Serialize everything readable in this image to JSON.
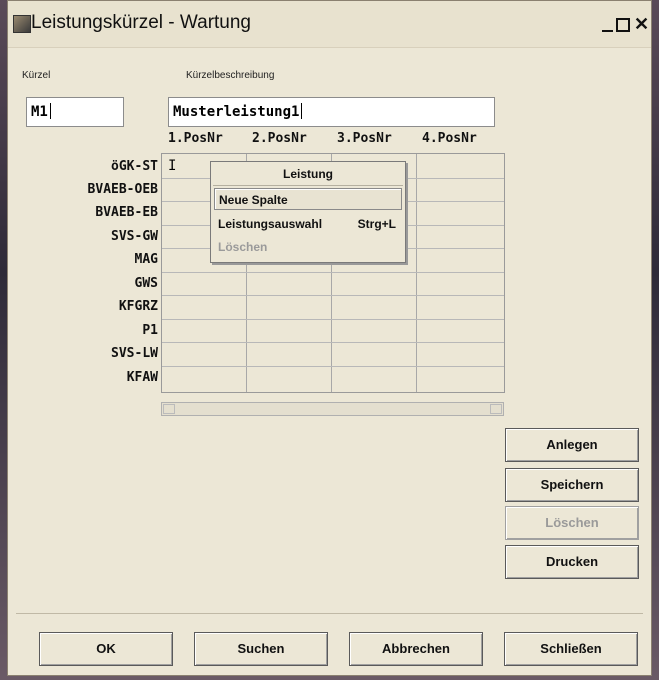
{
  "window": {
    "title": "Leistungskürzel - Wartung"
  },
  "form": {
    "kuerzel_label": "Kürzel",
    "kuerzel_value": "M1",
    "beschreibung_label": "Kürzelbeschreibung",
    "beschreibung_value": "Musterleistung1"
  },
  "grid": {
    "columns": [
      "1.PosNr",
      "2.PosNr",
      "3.PosNr",
      "4.PosNr"
    ],
    "rows": [
      "öGK-ST",
      "BVAEB-OEB",
      "BVAEB-EB",
      "SVS-GW",
      "MAG",
      "GWS",
      "KFGRZ",
      "P1",
      "SVS-LW",
      "KFAW"
    ]
  },
  "context_menu": {
    "title": "Leistung",
    "items": [
      {
        "label": "Neue Spalte",
        "shortcut": "",
        "state": "selected"
      },
      {
        "label": "Leistungsauswahl",
        "shortcut": "Strg+L",
        "state": "enabled"
      },
      {
        "label": "Löschen",
        "shortcut": "",
        "state": "disabled"
      }
    ]
  },
  "side_buttons": {
    "anlegen": "Anlegen",
    "speichern": "Speichern",
    "loeschen": "Löschen",
    "drucken": "Drucken"
  },
  "bottom_buttons": {
    "ok": "OK",
    "suchen": "Suchen",
    "abbrechen": "Abbrechen",
    "schliessen": "Schließen"
  }
}
